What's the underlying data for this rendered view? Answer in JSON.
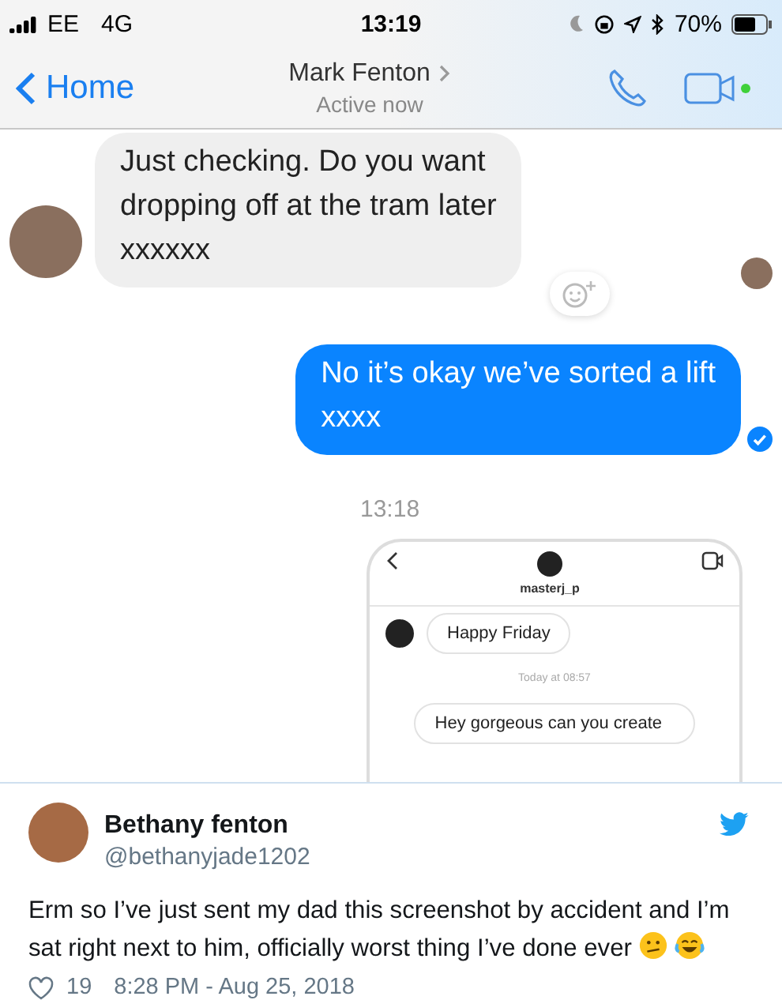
{
  "status_bar": {
    "carrier": "EE",
    "network": "4G",
    "time": "13:19",
    "battery": "70%"
  },
  "nav": {
    "back": "Home",
    "title": "Mark Fenton",
    "subtitle": "Active now",
    "video_online": true
  },
  "messages": [
    {
      "kind": "received",
      "text": "Just checking. Do you want\ndropping off at the tram later\nxxxxxx"
    },
    {
      "kind": "sent",
      "text": "No it’s okay we’ve sorted a lift\nxxxx",
      "delivered": true
    },
    {
      "kind": "time",
      "text": "13:18"
    },
    {
      "kind": "screenshot",
      "username": "masterj_p",
      "messages": [
        {
          "kind": "received",
          "text": "Happy Friday"
        },
        {
          "kind": "time",
          "text": "Today at 08:57"
        },
        {
          "kind": "sent",
          "text": "Hey gorgeous can you create"
        }
      ]
    }
  ],
  "tweet": {
    "name": "Bethany fenton",
    "handle": "@bethanyjade1202",
    "text": "Erm so I’ve just sent my dad this screenshot by accident and I’m sat right next to him, officially worst thing I’ve done ever",
    "likes": "19",
    "timestamp": "8:28 PM - Aug 25, 2018"
  }
}
